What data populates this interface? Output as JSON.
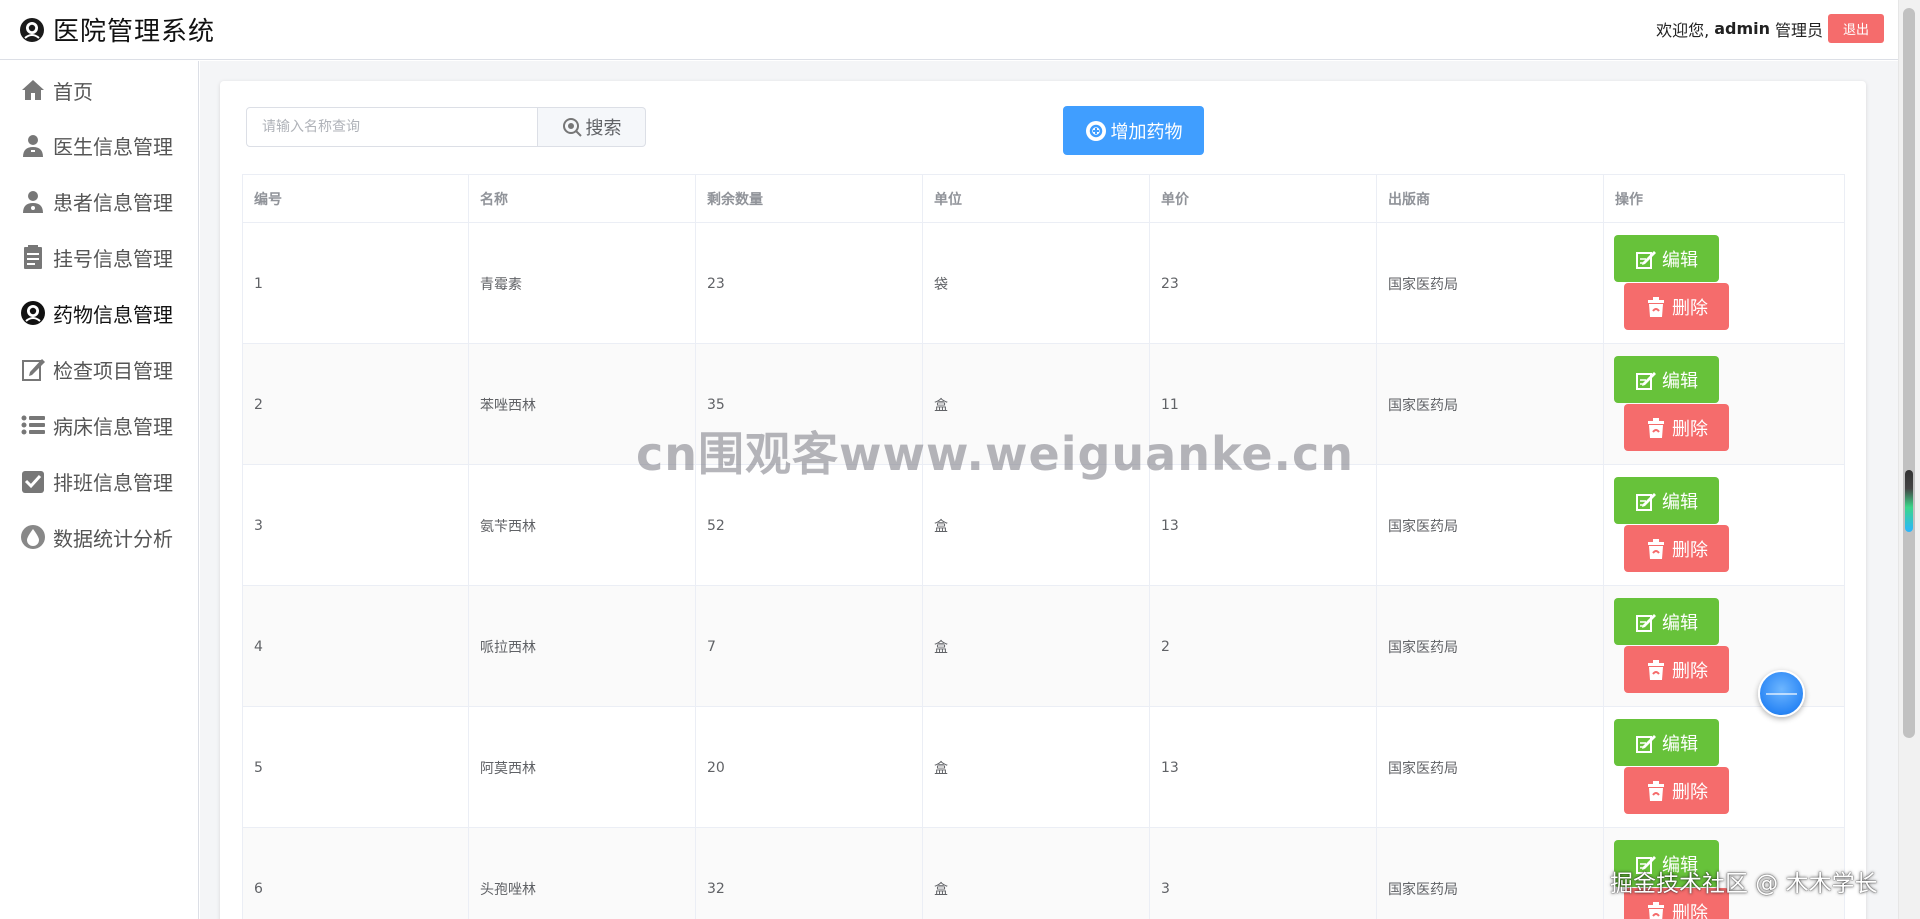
{
  "header": {
    "title": "医院管理系统",
    "welcome_prefix": "欢迎您,",
    "username": "admin",
    "role": "管理员",
    "logout_label": "退出"
  },
  "sidebar": {
    "items": [
      {
        "label": "首页",
        "icon": "home-icon"
      },
      {
        "label": "医生信息管理",
        "icon": "doctor-icon"
      },
      {
        "label": "患者信息管理",
        "icon": "patient-icon"
      },
      {
        "label": "挂号信息管理",
        "icon": "clipboard-icon"
      },
      {
        "label": "药物信息管理",
        "icon": "medicine-icon",
        "active": true
      },
      {
        "label": "检查项目管理",
        "icon": "edit-document-icon"
      },
      {
        "label": "病床信息管理",
        "icon": "list-icon"
      },
      {
        "label": "排班信息管理",
        "icon": "checkbox-icon"
      },
      {
        "label": "数据统计分析",
        "icon": "drop-icon"
      }
    ]
  },
  "toolbar": {
    "search_placeholder": "请输入名称查询",
    "search_label": "搜索",
    "add_label": "增加药物"
  },
  "table": {
    "columns": [
      "编号",
      "名称",
      "剩余数量",
      "单位",
      "单价",
      "出版商",
      "操作"
    ],
    "edit_label": "编辑",
    "delete_label": "删除",
    "rows": [
      {
        "id": "1",
        "name": "青霉素",
        "qty": "23",
        "unit": "袋",
        "price": "23",
        "publisher": "国家医药局"
      },
      {
        "id": "2",
        "name": "苯唑西林",
        "qty": "35",
        "unit": "盒",
        "price": "11",
        "publisher": "国家医药局"
      },
      {
        "id": "3",
        "name": "氨苄西林",
        "qty": "52",
        "unit": "盒",
        "price": "13",
        "publisher": "国家医药局"
      },
      {
        "id": "4",
        "name": "哌拉西林",
        "qty": "7",
        "unit": "盒",
        "price": "2",
        "publisher": "国家医药局"
      },
      {
        "id": "5",
        "name": "阿莫西林",
        "qty": "20",
        "unit": "盒",
        "price": "13",
        "publisher": "国家医药局"
      },
      {
        "id": "6",
        "name": "头孢唑林",
        "qty": "32",
        "unit": "盒",
        "price": "3",
        "publisher": "国家医药局"
      }
    ]
  },
  "overlays": {
    "watermark": "cn围观客www.weiguanke.cn",
    "corner_mark": "掘金技术社区 @ 木木学长"
  },
  "colors": {
    "primary": "#409eff",
    "success": "#67c23a",
    "danger": "#f56c6c"
  }
}
